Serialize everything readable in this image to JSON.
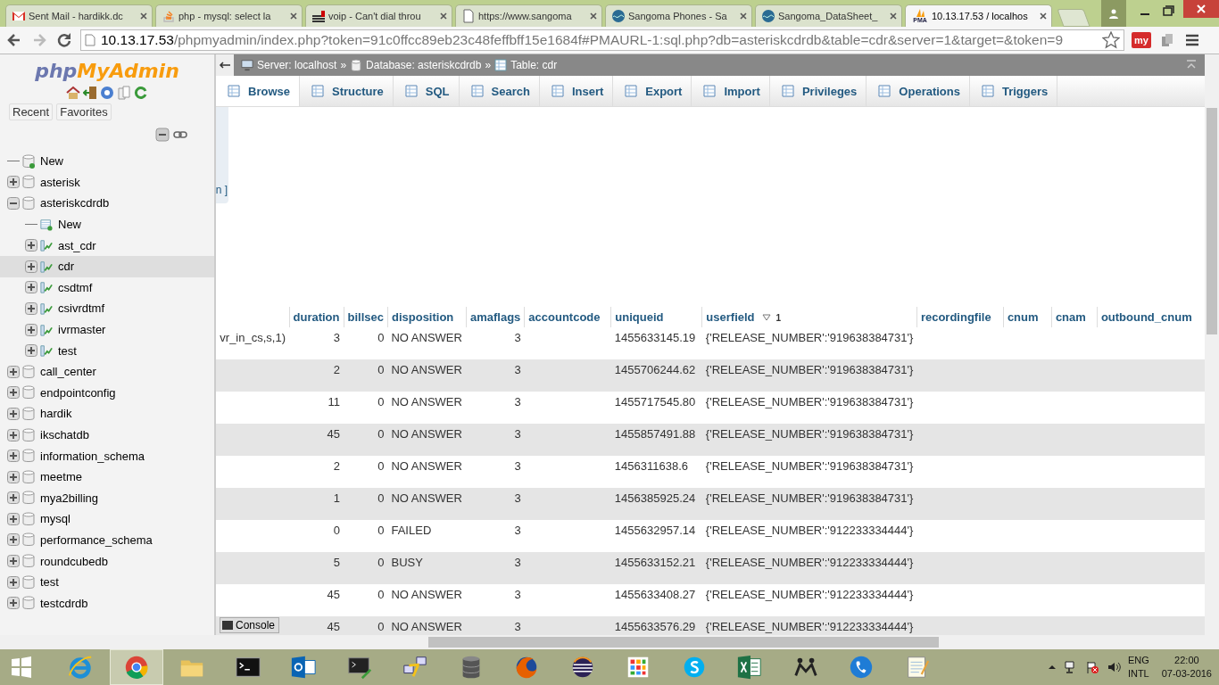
{
  "browser": {
    "tabs": [
      {
        "title": "Sent Mail - hardikk.dc",
        "kind": "mail",
        "selected": false
      },
      {
        "title": "php - mysql: select la",
        "kind": "stack",
        "selected": false
      },
      {
        "title": "voip - Can't dial throu",
        "kind": "bars",
        "selected": false
      },
      {
        "title": "https://www.sangoma",
        "kind": "page",
        "selected": false
      },
      {
        "title": "Sangoma Phones - Sa",
        "kind": "globe",
        "selected": false
      },
      {
        "title": "Sangoma_DataSheet_",
        "kind": "globe",
        "selected": false
      },
      {
        "title": "10.13.17.53 / localhos",
        "kind": "pma",
        "selected": true
      }
    ],
    "pma_badge": "PMA",
    "address": {
      "host": "10.13.17.53",
      "path": "/phpmyadmin/index.php?token=91c0ffcc89eb23c48feffbff15e1684f#PMAURL-1:sql.php?db=asteriskcdrdb&table=cdr&server=1&target=&token=9"
    },
    "extension_label": "my"
  },
  "sidebar": {
    "logo": {
      "prefix": "php",
      "name": "MyAdmin"
    },
    "buttons": [
      "Recent",
      "Favorites"
    ],
    "tree": [
      {
        "label": "New",
        "kind": "new",
        "selected": false
      },
      {
        "label": "asterisk",
        "kind": "db",
        "expanded": false,
        "selected": false
      },
      {
        "label": "asteriskcdrdb",
        "kind": "db",
        "expanded": true,
        "selected": false,
        "children": [
          {
            "label": "New",
            "kind": "new",
            "selected": false
          },
          {
            "label": "ast_cdr",
            "kind": "table",
            "expanded": false,
            "selected": false
          },
          {
            "label": "cdr",
            "kind": "table",
            "expanded": false,
            "selected": true
          },
          {
            "label": "csdtmf",
            "kind": "table",
            "expanded": false,
            "selected": false
          },
          {
            "label": "csivrdtmf",
            "kind": "table",
            "expanded": false,
            "selected": false
          },
          {
            "label": "ivrmaster",
            "kind": "table",
            "expanded": false,
            "selected": false
          },
          {
            "label": "test",
            "kind": "table",
            "expanded": false,
            "selected": false
          }
        ]
      },
      {
        "label": "call_center",
        "kind": "db",
        "expanded": false,
        "selected": false
      },
      {
        "label": "endpointconfig",
        "kind": "db",
        "expanded": false,
        "selected": false
      },
      {
        "label": "hardik",
        "kind": "db",
        "expanded": false,
        "selected": false
      },
      {
        "label": "ikschatdb",
        "kind": "db",
        "expanded": false,
        "selected": false
      },
      {
        "label": "information_schema",
        "kind": "db",
        "expanded": false,
        "selected": false
      },
      {
        "label": "meetme",
        "kind": "db",
        "expanded": false,
        "selected": false
      },
      {
        "label": "mya2billing",
        "kind": "db",
        "expanded": false,
        "selected": false
      },
      {
        "label": "mysql",
        "kind": "db",
        "expanded": false,
        "selected": false
      },
      {
        "label": "performance_schema",
        "kind": "db",
        "expanded": false,
        "selected": false
      },
      {
        "label": "roundcubedb",
        "kind": "db",
        "expanded": false,
        "selected": false
      },
      {
        "label": "test",
        "kind": "db",
        "expanded": false,
        "selected": false
      },
      {
        "label": "testcdrdb",
        "kind": "db",
        "expanded": false,
        "selected": false
      }
    ]
  },
  "breadcrumb": {
    "server": "Server: localhost",
    "database": "Database: asteriskcdrdb",
    "table": "Table: cdr",
    "separator": "»"
  },
  "tabs": [
    {
      "label": "Browse",
      "selected": true
    },
    {
      "label": "Structure",
      "selected": false
    },
    {
      "label": "SQL",
      "selected": false
    },
    {
      "label": "Search",
      "selected": false
    },
    {
      "label": "Insert",
      "selected": false
    },
    {
      "label": "Export",
      "selected": false
    },
    {
      "label": "Import",
      "selected": false
    },
    {
      "label": "Privileges",
      "selected": false
    },
    {
      "label": "Operations",
      "selected": false
    },
    {
      "label": "Triggers",
      "selected": false
    }
  ],
  "fragment": "n ]",
  "table": {
    "columns": [
      {
        "label": "duration"
      },
      {
        "label": "billsec"
      },
      {
        "label": "disposition"
      },
      {
        "label": "amaflags"
      },
      {
        "label": "accountcode"
      },
      {
        "label": "uniqueid"
      },
      {
        "label": "userfield",
        "sort_descending": true,
        "sort_order": "1"
      },
      {
        "label": "recordingfile"
      },
      {
        "label": "cnum"
      },
      {
        "label": "cnam"
      },
      {
        "label": "outbound_cnum"
      }
    ],
    "rows": [
      {
        "column_1": "vr_in_cs,s,1)",
        "duration": "3",
        "billsec": "0",
        "disposition": "NO ANSWER",
        "amaflags": "3",
        "uniqueid": "1455633145.19",
        "userfield": "{'RELEASE_NUMBER':'919638384731'}"
      },
      {
        "duration": "2",
        "billsec": "0",
        "disposition": "NO ANSWER",
        "amaflags": "3",
        "uniqueid": "1455706244.62",
        "userfield": "{'RELEASE_NUMBER':'919638384731'}"
      },
      {
        "duration": "11",
        "billsec": "0",
        "disposition": "NO ANSWER",
        "amaflags": "3",
        "uniqueid": "1455717545.80",
        "userfield": "{'RELEASE_NUMBER':'919638384731'}"
      },
      {
        "duration": "45",
        "billsec": "0",
        "disposition": "NO ANSWER",
        "amaflags": "3",
        "uniqueid": "1455857491.88",
        "userfield": "{'RELEASE_NUMBER':'919638384731'}"
      },
      {
        "duration": "2",
        "billsec": "0",
        "disposition": "NO ANSWER",
        "amaflags": "3",
        "uniqueid": "1456311638.6",
        "userfield": "{'RELEASE_NUMBER':'919638384731'}"
      },
      {
        "duration": "1",
        "billsec": "0",
        "disposition": "NO ANSWER",
        "amaflags": "3",
        "uniqueid": "1456385925.24",
        "userfield": "{'RELEASE_NUMBER':'919638384731'}"
      },
      {
        "duration": "0",
        "billsec": "0",
        "disposition": "FAILED",
        "amaflags": "3",
        "uniqueid": "1455632957.14",
        "userfield": "{'RELEASE_NUMBER':'912233334444'}"
      },
      {
        "duration": "5",
        "billsec": "0",
        "disposition": "BUSY",
        "amaflags": "3",
        "uniqueid": "1455633152.21",
        "userfield": "{'RELEASE_NUMBER':'912233334444'}"
      },
      {
        "duration": "45",
        "billsec": "0",
        "disposition": "NO ANSWER",
        "amaflags": "3",
        "uniqueid": "1455633408.27",
        "userfield": "{'RELEASE_NUMBER':'912233334444'}"
      },
      {
        "duration": "45",
        "billsec": "0",
        "disposition": "NO ANSWER",
        "amaflags": "3",
        "uniqueid": "1455633576.29",
        "userfield": "{'RELEASE_NUMBER':'912233334444'}"
      }
    ]
  },
  "console": "Console",
  "taskbar": {
    "apps": [
      {
        "kind": "ie",
        "selected": false
      },
      {
        "kind": "chrome",
        "selected": true
      },
      {
        "kind": "folder",
        "selected": false
      },
      {
        "kind": "cmd",
        "selected": false
      },
      {
        "kind": "outlook",
        "selected": false
      },
      {
        "kind": "terminal",
        "selected": false
      },
      {
        "kind": "network",
        "selected": false
      },
      {
        "kind": "database",
        "selected": false
      },
      {
        "kind": "firefox",
        "selected": false
      },
      {
        "kind": "sphere",
        "selected": false
      },
      {
        "kind": "grid",
        "selected": false
      },
      {
        "kind": "chat",
        "selected": false
      },
      {
        "kind": "excel",
        "selected": false
      },
      {
        "kind": "people",
        "selected": false
      },
      {
        "kind": "phone",
        "selected": false
      },
      {
        "kind": "notepad",
        "selected": false
      }
    ],
    "language": "ENG",
    "layout": "INTL",
    "time": "22:00",
    "date": "07-03-2016"
  }
}
